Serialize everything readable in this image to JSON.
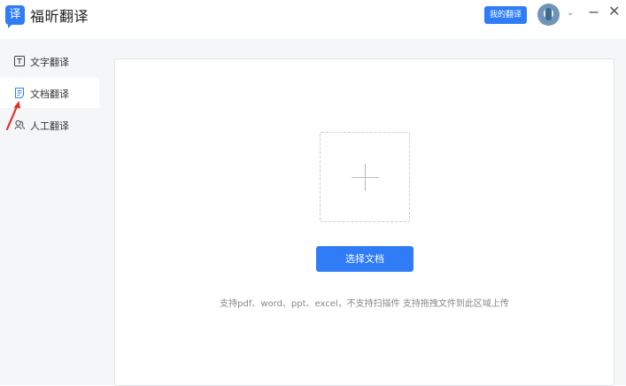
{
  "app": {
    "logo_char": "译",
    "name": "福昕翻译"
  },
  "header": {
    "my_translations_label": "我的翻译",
    "avatar_icon": "avatar-icon",
    "dropdown_icon": "chevron-down-icon"
  },
  "window": {
    "minimize": "−",
    "close": "✕"
  },
  "sidebar": {
    "items": [
      {
        "label": "文字翻译",
        "icon": "text-icon",
        "active": false
      },
      {
        "label": "文档翻译",
        "icon": "document-icon",
        "active": true
      },
      {
        "label": "人工翻译",
        "icon": "human-icon",
        "active": false
      }
    ]
  },
  "main": {
    "upload_button_label": "选择文档",
    "hint": "支持pdf、word、ppt、excel，不支持扫描件 支持拖拽文件到此区域上传"
  },
  "colors": {
    "accent": "#2f7cf6",
    "annotation_arrow": "#e0312f"
  }
}
